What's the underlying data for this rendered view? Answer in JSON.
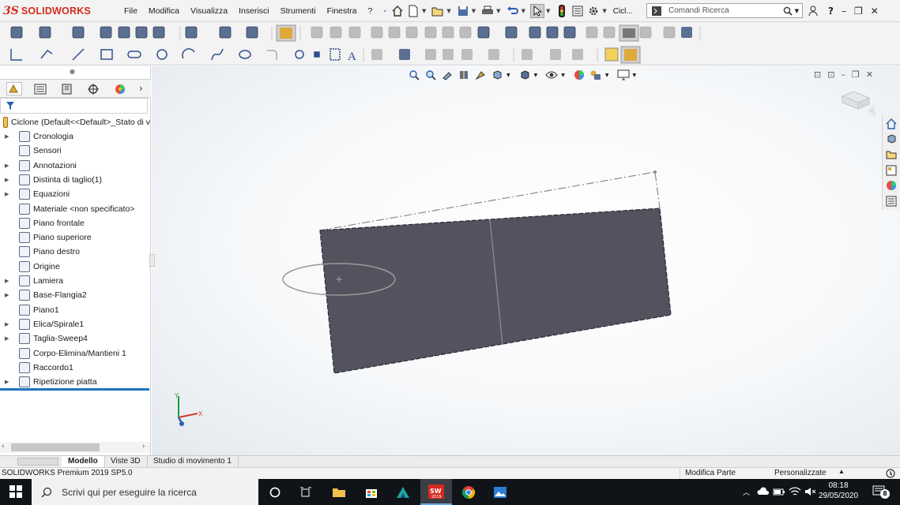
{
  "app": {
    "brand_prefix": "3S",
    "brand_name": "SOLIDWORKS"
  },
  "menu": [
    "File",
    "Modifica",
    "Visualizza",
    "Inserisci",
    "Strumenti",
    "Finestra",
    "?"
  ],
  "quick_access": {
    "doc_label": "Cicl...",
    "icons": [
      "home-icon",
      "new-document-icon",
      "open-icon",
      "save-icon",
      "print-icon",
      "undo-icon",
      "select-icon",
      "traffic-light-icon",
      "file-properties-icon",
      "options-gear-icon"
    ]
  },
  "search": {
    "placeholder": "Comandi Ricerca",
    "help": "?"
  },
  "feature_tree": {
    "root": "Ciclone  (Default<<Default>_Stato di v",
    "items": [
      {
        "label": "Cronologia",
        "expandable": true,
        "icon": "history-icon"
      },
      {
        "label": "Sensori",
        "expandable": false,
        "icon": "sensor-icon"
      },
      {
        "label": "Annotazioni",
        "expandable": true,
        "icon": "annotation-icon"
      },
      {
        "label": "Distinta di taglio(1)",
        "expandable": true,
        "icon": "cut-list-icon"
      },
      {
        "label": "Equazioni",
        "expandable": true,
        "icon": "equation-icon"
      },
      {
        "label": "Materiale <non specificato>",
        "expandable": false,
        "icon": "material-icon"
      },
      {
        "label": "Piano frontale",
        "expandable": false,
        "icon": "plane-icon"
      },
      {
        "label": "Piano superiore",
        "expandable": false,
        "icon": "plane-icon"
      },
      {
        "label": "Piano destro",
        "expandable": false,
        "icon": "plane-icon"
      },
      {
        "label": "Origine",
        "expandable": false,
        "icon": "origin-icon"
      },
      {
        "label": "Lamiera",
        "expandable": true,
        "icon": "sheet-metal-icon"
      },
      {
        "label": "Base-Flangia2",
        "expandable": true,
        "icon": "base-flange-icon"
      },
      {
        "label": "Piano1",
        "expandable": false,
        "icon": "plane-icon"
      },
      {
        "label": "Elica/Spirale1",
        "expandable": true,
        "icon": "helix-icon"
      },
      {
        "label": "Taglia-Sweep4",
        "expandable": true,
        "icon": "sweep-cut-icon"
      },
      {
        "label": "Corpo-Elimina/Mantieni 1",
        "expandable": false,
        "icon": "delete-body-icon"
      },
      {
        "label": "Raccordo1",
        "expandable": false,
        "icon": "fillet-icon"
      },
      {
        "label": "Ripetizione piatta",
        "expandable": true,
        "icon": "flat-pattern-icon"
      }
    ]
  },
  "triad": {
    "y": "Y",
    "x": "X"
  },
  "doc_tabs": [
    "Modello",
    "Viste 3D",
    "Studio di movimento 1"
  ],
  "status": {
    "product": "SOLIDWORKS Premium 2019 SP5.0",
    "mode": "Modifica Parte",
    "custom": "Personalizzate"
  },
  "taskbar": {
    "search_placeholder": "Scrivi qui per eseguire la ricerca",
    "time": "08:18",
    "date": "29/05/2020",
    "notifications": "8",
    "sw_badge": "2019"
  },
  "colors": {
    "brand": "#d52b1e",
    "part_face": "#52535e",
    "selection_blue": "#1e73be"
  }
}
